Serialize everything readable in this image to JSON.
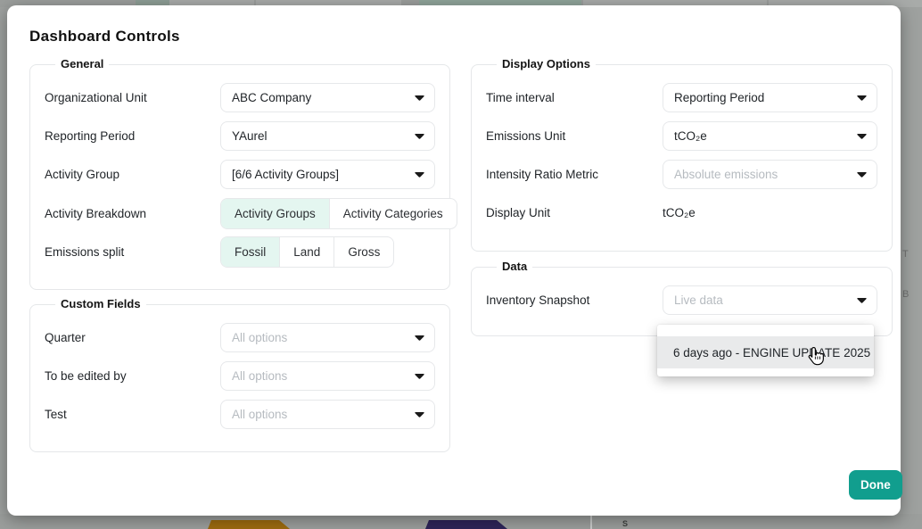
{
  "backdrop": {
    "bottom_glyph": "S",
    "right_text_top": "T",
    "right_text_bottom": "B"
  },
  "modal": {
    "title": "Dashboard Controls",
    "done_label": "Done"
  },
  "general": {
    "legend": "General",
    "org_unit_label": "Organizational Unit",
    "org_unit_value": "ABC Company",
    "reporting_period_label": "Reporting Period",
    "reporting_period_value": "YAurel",
    "activity_group_label": "Activity Group",
    "activity_group_value": "[6/6 Activity Groups]",
    "activity_breakdown_label": "Activity Breakdown",
    "activity_breakdown_options": [
      "Activity Groups",
      "Activity Categories"
    ],
    "activity_breakdown_selected": "Activity Groups",
    "emissions_split_label": "Emissions split",
    "emissions_split_options": [
      "Fossil",
      "Land",
      "Gross"
    ],
    "emissions_split_selected": "Fossil"
  },
  "custom_fields": {
    "legend": "Custom Fields",
    "quarter_label": "Quarter",
    "quarter_placeholder": "All options",
    "edited_by_label": "To be edited by",
    "edited_by_placeholder": "All options",
    "test_label": "Test",
    "test_placeholder": "All options"
  },
  "display_options": {
    "legend": "Display Options",
    "time_interval_label": "Time interval",
    "time_interval_value": "Reporting Period",
    "emissions_unit_label": "Emissions Unit",
    "emissions_unit_value": "tCO₂e",
    "intensity_label": "Intensity Ratio Metric",
    "intensity_placeholder": "Absolute emissions",
    "display_unit_label": "Display Unit",
    "display_unit_value": "tCO₂e"
  },
  "data_section": {
    "legend": "Data",
    "inventory_label": "Inventory Snapshot",
    "inventory_placeholder": "Live data",
    "dropdown_option": "6 days ago - ENGINE UPDATE 2025"
  },
  "colors": {
    "accent_teal": "#119e8e",
    "selected_mint": "#e4f6f0",
    "hover_gray": "#e9eaeb",
    "backdrop_gray": "#9ea19f"
  }
}
